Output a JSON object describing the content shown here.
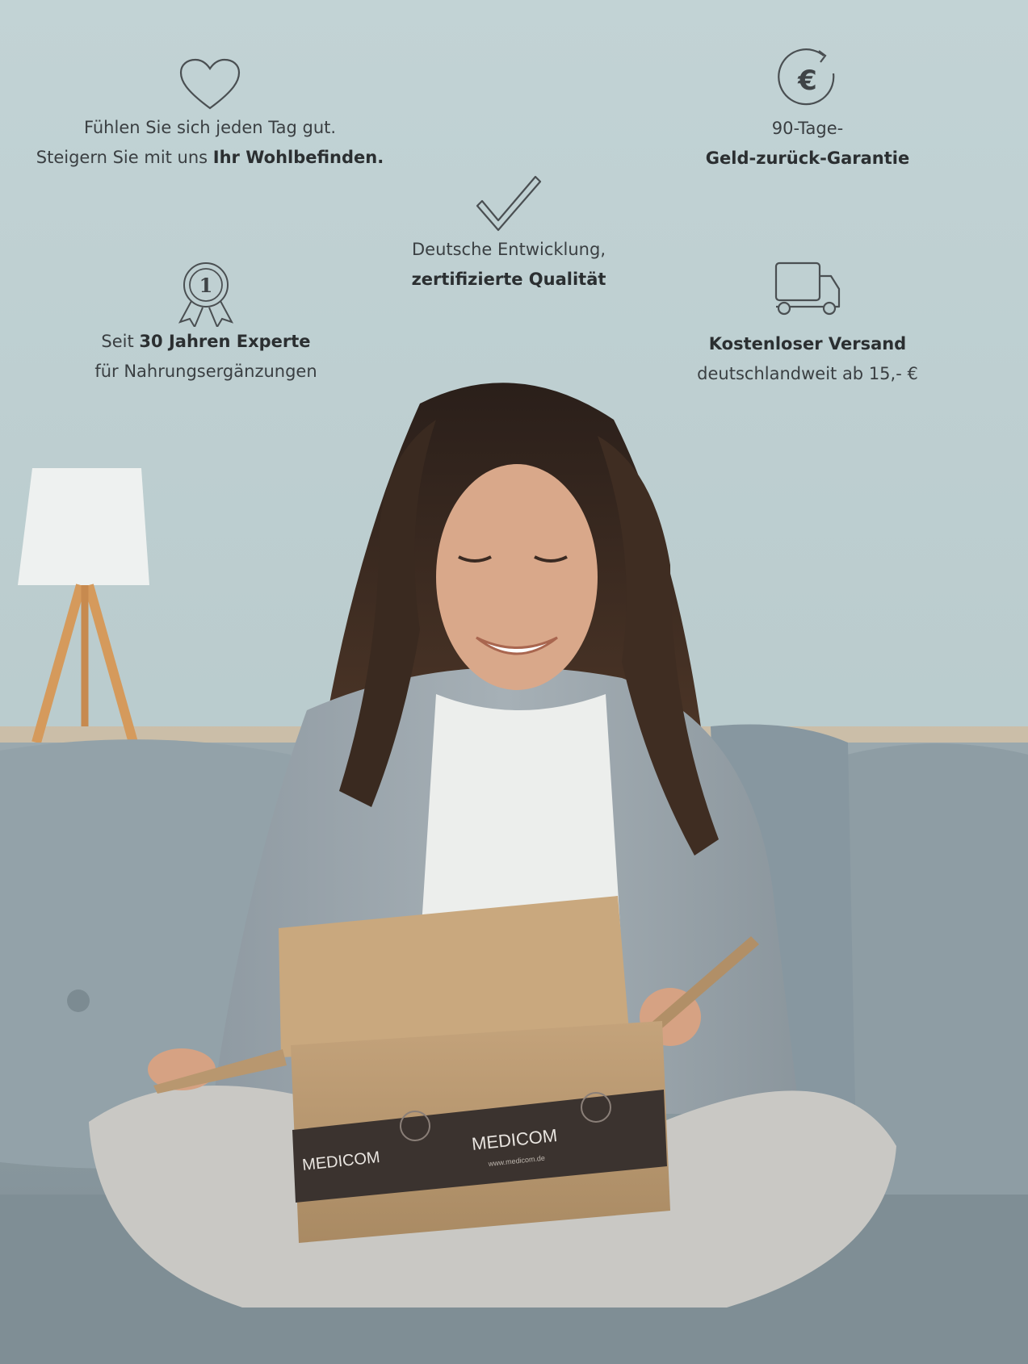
{
  "features": {
    "wellbeing": {
      "icon": "heart-icon",
      "line1": "Fühlen Sie sich jeden Tag gut.",
      "line2_pre": "Steigern Sie mit uns ",
      "line2_bold": "Ihr Wohlbefinden."
    },
    "guarantee": {
      "icon": "euro-refresh-icon",
      "line1": "90-Tage-",
      "line2_bold": "Geld-zurück-Garantie"
    },
    "quality": {
      "icon": "checkmark-icon",
      "line1": "Deutsche Entwicklung,",
      "line2_bold": "zertifizierte Qualität"
    },
    "expert": {
      "icon": "award-ribbon-icon",
      "badge_number": "1",
      "line1_pre": "Seit ",
      "line1_bold": "30 Jahren Experte",
      "line2": "für Nahrungsergänzungen"
    },
    "shipping": {
      "icon": "delivery-truck-icon",
      "line1_bold": "Kostenloser Versand",
      "line2": "deutschlandweit ab 15,- €"
    }
  },
  "package": {
    "brand": "MEDICOM",
    "url": "www.medicom.de"
  },
  "colors": {
    "wall": "#bccdcf",
    "sofa": "#8d9ca3",
    "cardboard": "#b8976f",
    "tape": "#3a322e",
    "text": "#3a3f42"
  }
}
